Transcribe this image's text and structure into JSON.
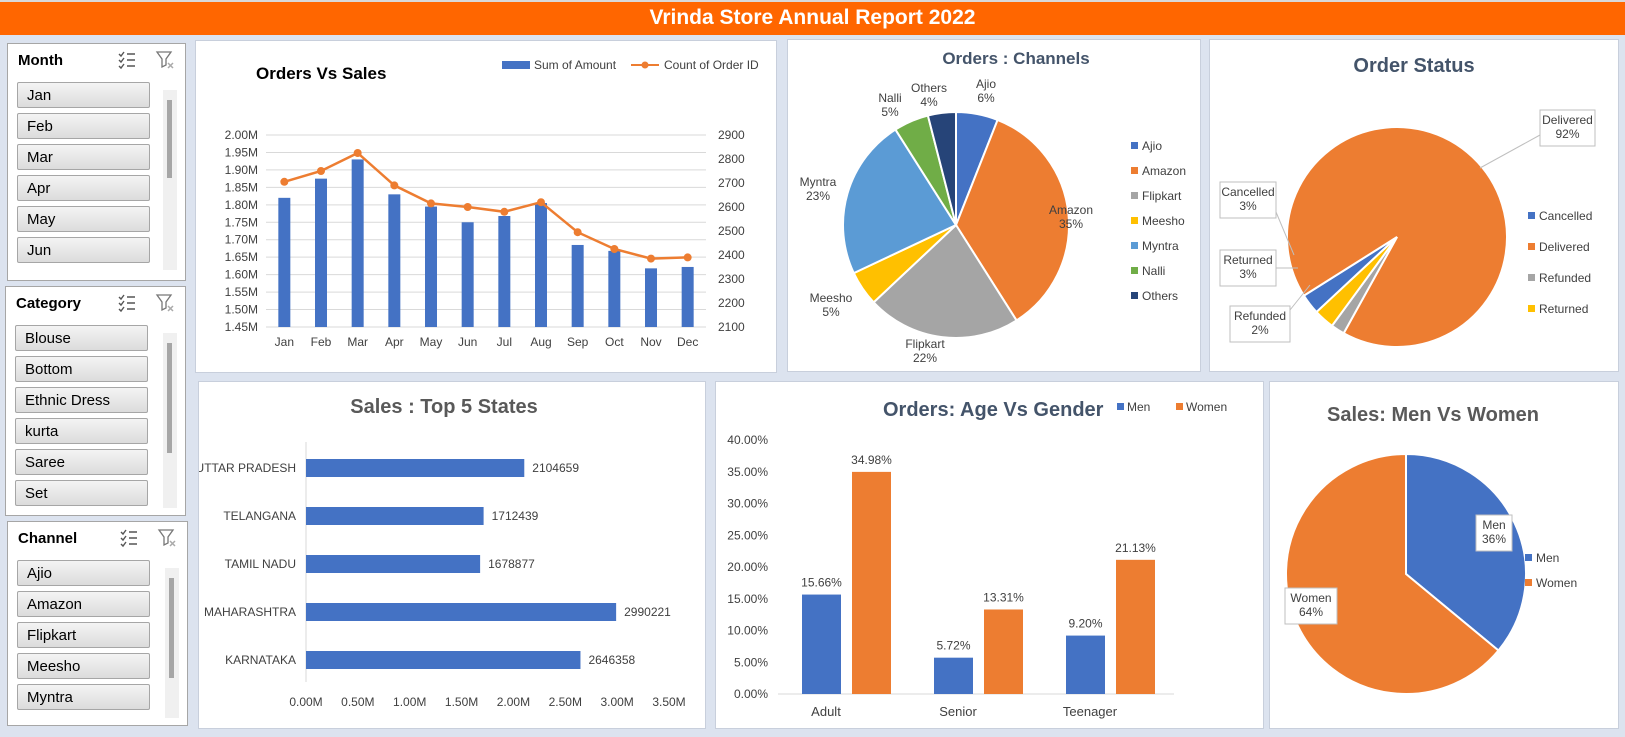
{
  "report": {
    "title": "Vrinda Store Annual Report 2022"
  },
  "slicers": {
    "month": {
      "title": "Month",
      "items": [
        "Jan",
        "Feb",
        "Mar",
        "Apr",
        "May",
        "Jun"
      ]
    },
    "category": {
      "title": "Category",
      "items": [
        "Blouse",
        "Bottom",
        "Ethnic Dress",
        "kurta",
        "Saree",
        "Set"
      ]
    },
    "channel": {
      "title": "Channel",
      "items": [
        "Ajio",
        "Amazon",
        "Flipkart",
        "Meesho",
        "Myntra"
      ]
    }
  },
  "colors": {
    "header": "#ff6600",
    "blue": "#4472c4",
    "orange": "#ed7d31",
    "gray": "#a5a5a5",
    "yellow": "#ffc000",
    "lightblue": "#5b9bd5",
    "green": "#70ad47",
    "navy": "#264478"
  },
  "chart_data": [
    {
      "id": "orders_vs_sales",
      "type": "bar",
      "title": "Orders Vs Sales",
      "categories": [
        "Jan",
        "Feb",
        "Mar",
        "Apr",
        "May",
        "Jun",
        "Jul",
        "Aug",
        "Sep",
        "Oct",
        "Nov",
        "Dec"
      ],
      "series": [
        {
          "name": "Sum of Amount",
          "type": "bar",
          "axis": "left",
          "values": [
            1820000,
            1875000,
            1930000,
            1830000,
            1795000,
            1750000,
            1768000,
            1805000,
            1685000,
            1668000,
            1618000,
            1622000
          ]
        },
        {
          "name": "Count of Order ID",
          "type": "line",
          "axis": "right",
          "values": [
            2705,
            2750,
            2825,
            2690,
            2615,
            2600,
            2580,
            2620,
            2495,
            2425,
            2385,
            2390
          ]
        }
      ],
      "left_ticks": [
        "1.45M",
        "1.50M",
        "1.55M",
        "1.60M",
        "1.65M",
        "1.70M",
        "1.75M",
        "1.80M",
        "1.85M",
        "1.90M",
        "1.95M",
        "2.00M"
      ],
      "right_ticks": [
        "2100",
        "2200",
        "2300",
        "2400",
        "2500",
        "2600",
        "2700",
        "2800",
        "2900"
      ],
      "ylim_left": [
        1450000,
        2000000
      ],
      "ylim_right": [
        2100,
        2900
      ],
      "grid": true,
      "legend_position": "top-right"
    },
    {
      "id": "orders_channels",
      "type": "pie",
      "title": "Orders : Channels",
      "slices": [
        {
          "label": "Ajio",
          "value": 6,
          "color": "#4472c4"
        },
        {
          "label": "Amazon",
          "value": 35,
          "color": "#ed7d31"
        },
        {
          "label": "Flipkart",
          "value": 22,
          "color": "#a5a5a5"
        },
        {
          "label": "Meesho",
          "value": 5,
          "color": "#ffc000"
        },
        {
          "label": "Myntra",
          "value": 23,
          "color": "#5b9bd5"
        },
        {
          "label": "Nalli",
          "value": 5,
          "color": "#70ad47"
        },
        {
          "label": "Others",
          "value": 4,
          "color": "#264478"
        }
      ],
      "data_labels": [
        "Ajio\n6%",
        "Amazon\n35%",
        "Flipkart\n22%",
        "Meesho\n5%",
        "Myntra\n23%",
        "Nalli\n5%",
        "Others\n4%"
      ],
      "legend_position": "right"
    },
    {
      "id": "order_status",
      "type": "pie",
      "title": "Order Status",
      "slices": [
        {
          "label": "Cancelled",
          "value": 3,
          "color": "#4472c4"
        },
        {
          "label": "Delivered",
          "value": 92,
          "color": "#ed7d31"
        },
        {
          "label": "Refunded",
          "value": 2,
          "color": "#a5a5a5"
        },
        {
          "label": "Returned",
          "value": 3,
          "color": "#ffc000"
        }
      ],
      "data_labels": [
        "Cancelled\n3%",
        "Delivered\n92%",
        "Refunded\n2%",
        "Returned\n3%"
      ],
      "legend_position": "right"
    },
    {
      "id": "top5_states",
      "type": "bar",
      "orientation": "horizontal",
      "title": "Sales : Top 5 States",
      "categories": [
        "UTTAR PRADESH",
        "TELANGANA",
        "TAMIL NADU",
        "MAHARASHTRA",
        "KARNATAKA"
      ],
      "values": [
        2104659,
        1712439,
        1678877,
        2990221,
        2646358
      ],
      "x_ticks": [
        "0.00M",
        "0.50M",
        "1.00M",
        "1.50M",
        "2.00M",
        "2.50M",
        "3.00M",
        "3.50M"
      ],
      "xlim": [
        0,
        3500000
      ]
    },
    {
      "id": "age_vs_gender",
      "type": "bar",
      "title": "Orders: Age Vs Gender",
      "categories": [
        "Adult",
        "Senior",
        "Teenager"
      ],
      "series": [
        {
          "name": "Men",
          "values": [
            15.66,
            5.72,
            9.2
          ],
          "labels": [
            "15.66%",
            "5.72%",
            "9.20%"
          ]
        },
        {
          "name": "Women",
          "values": [
            34.98,
            13.31,
            21.13
          ],
          "labels": [
            "34.98%",
            "13.31%",
            "21.13%"
          ]
        }
      ],
      "y_ticks": [
        "0.00%",
        "5.00%",
        "10.00%",
        "15.00%",
        "20.00%",
        "25.00%",
        "30.00%",
        "35.00%",
        "40.00%"
      ],
      "ylim": [
        0,
        40
      ],
      "legend_position": "top-right"
    },
    {
      "id": "men_vs_women",
      "type": "pie",
      "title": "Sales: Men Vs Women",
      "slices": [
        {
          "label": "Men",
          "value": 36,
          "color": "#4472c4"
        },
        {
          "label": "Women",
          "value": 64,
          "color": "#ed7d31"
        }
      ],
      "data_labels": [
        "Men\n36%",
        "Women\n64%"
      ],
      "legend_position": "right"
    }
  ]
}
